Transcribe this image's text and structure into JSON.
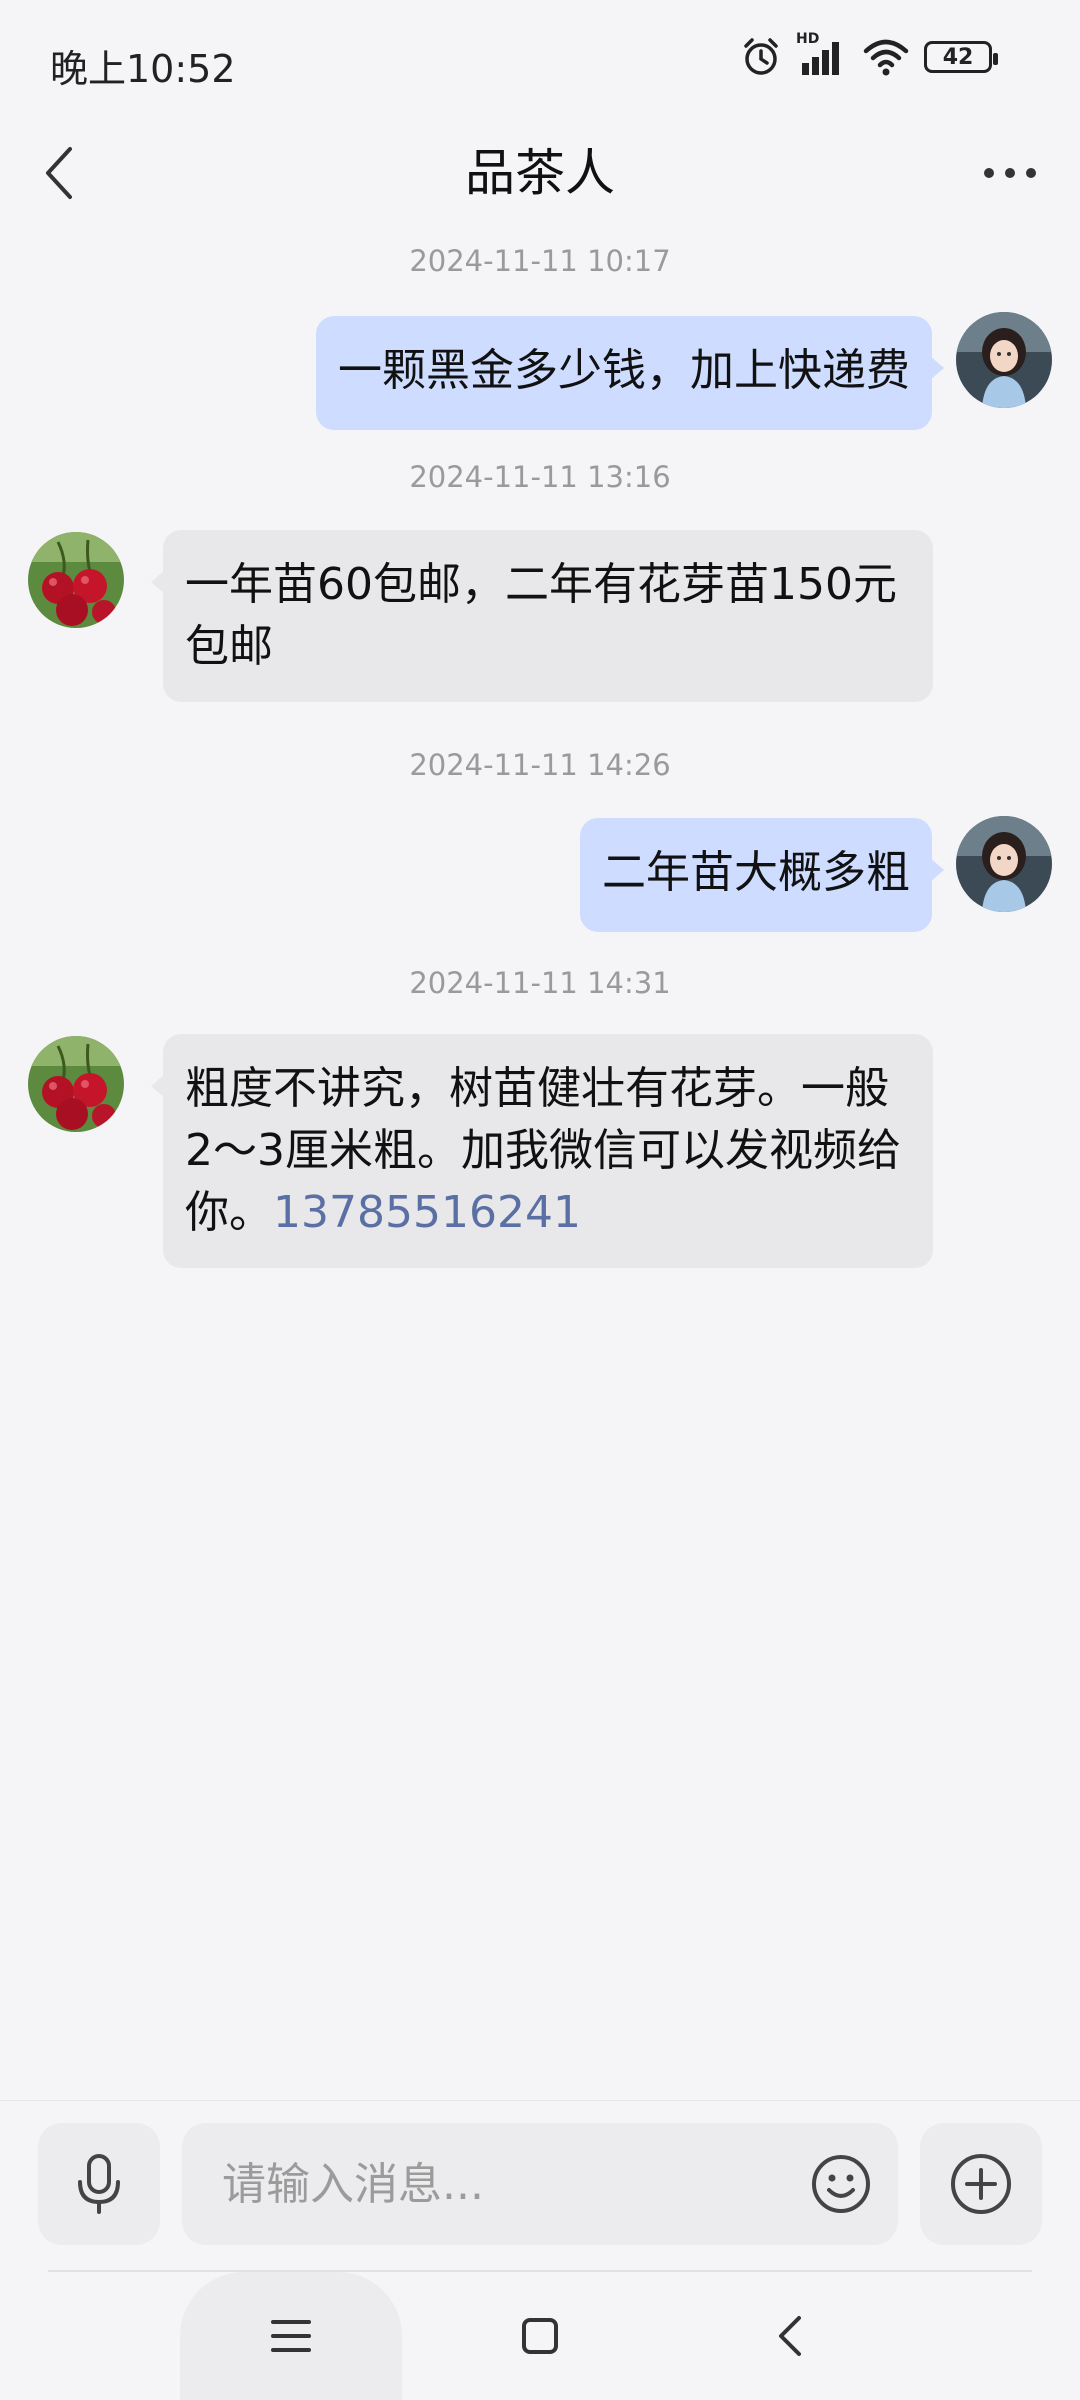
{
  "status_bar": {
    "time": "晚上10:52",
    "hd_label": "HD",
    "battery": "42",
    "icons": [
      "alarm-icon",
      "signal-icon",
      "wifi-icon",
      "battery-icon"
    ]
  },
  "header": {
    "title": "品茶人",
    "back_icon": "chevron-left-icon",
    "more_icon": "more-dots-icon"
  },
  "messages": [
    {
      "timestamp": "2024-11-11 10:17",
      "sender": "me",
      "text": "一颗黑金多少钱，加上快递费"
    },
    {
      "timestamp": "2024-11-11 13:16",
      "sender": "them",
      "text": "一年苗60包邮，二年有花芽苗150元包邮"
    },
    {
      "timestamp": "2024-11-11 14:26",
      "sender": "me",
      "text": "二年苗大概多粗"
    },
    {
      "timestamp": "2024-11-11 14:31",
      "sender": "them",
      "text": "粗度不讲究，树苗健壮有花芽。一般2～3厘米粗。加我微信可以发视频给你。",
      "phone": "13785516241"
    }
  ],
  "input_bar": {
    "placeholder": "请输入消息...",
    "value": "",
    "icons": [
      "microphone-icon",
      "emoji-icon",
      "plus-circle-icon"
    ]
  },
  "nav_bar": {
    "icons": [
      "menu-icon",
      "home-square-icon",
      "back-chevron-icon"
    ]
  },
  "colors": {
    "my_bubble": "#cddcff",
    "their_bubble": "#e8e8ea",
    "background": "#f5f5f7",
    "phone_link": "#5a6fa3"
  }
}
